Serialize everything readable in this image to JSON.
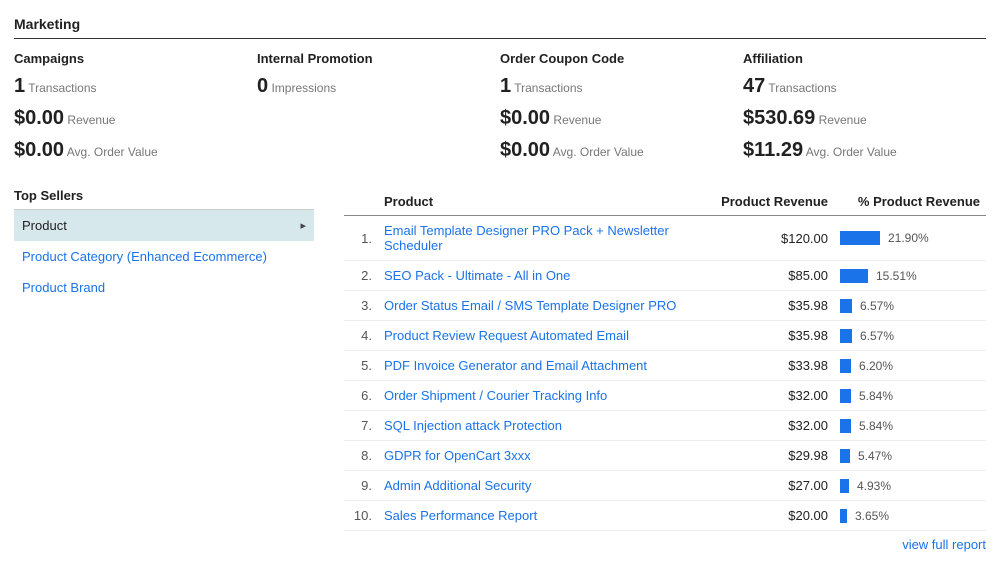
{
  "section_title": "Marketing",
  "accent": "#1a73e8",
  "metrics": [
    {
      "title": "Campaigns",
      "lines": [
        {
          "big": "1",
          "label": "Transactions"
        },
        {
          "big": "$0.00",
          "label": "Revenue"
        },
        {
          "big": "$0.00",
          "label": "Avg. Order Value"
        }
      ]
    },
    {
      "title": "Internal Promotion",
      "lines": [
        {
          "big": "0",
          "label": "Impressions"
        }
      ]
    },
    {
      "title": "Order Coupon Code",
      "lines": [
        {
          "big": "1",
          "label": "Transactions"
        },
        {
          "big": "$0.00",
          "label": "Revenue"
        },
        {
          "big": "$0.00",
          "label": "Avg. Order Value"
        }
      ]
    },
    {
      "title": "Affiliation",
      "lines": [
        {
          "big": "47",
          "label": "Transactions"
        },
        {
          "big": "$530.69",
          "label": "Revenue"
        },
        {
          "big": "$11.29",
          "label": "Avg. Order Value"
        }
      ]
    }
  ],
  "top_sellers": {
    "title": "Top Sellers",
    "items": [
      {
        "label": "Product",
        "active": true
      },
      {
        "label": "Product Category (Enhanced Ecommerce)",
        "active": false
      },
      {
        "label": "Product Brand",
        "active": false
      }
    ]
  },
  "table": {
    "columns": {
      "product": "Product",
      "revenue": "Product Revenue",
      "pct": "% Product Revenue"
    },
    "rows": [
      {
        "idx": "1.",
        "name": "Email Template Designer PRO Pack + Newsletter Scheduler",
        "revenue": "$120.00",
        "pct": "21.90%",
        "pct_val": 21.9
      },
      {
        "idx": "2.",
        "name": "SEO Pack - Ultimate - All in One",
        "revenue": "$85.00",
        "pct": "15.51%",
        "pct_val": 15.51
      },
      {
        "idx": "3.",
        "name": "Order Status Email / SMS Template Designer PRO",
        "revenue": "$35.98",
        "pct": "6.57%",
        "pct_val": 6.57
      },
      {
        "idx": "4.",
        "name": "Product Review Request Automated Email",
        "revenue": "$35.98",
        "pct": "6.57%",
        "pct_val": 6.57
      },
      {
        "idx": "5.",
        "name": "PDF Invoice Generator and Email Attachment",
        "revenue": "$33.98",
        "pct": "6.20%",
        "pct_val": 6.2
      },
      {
        "idx": "6.",
        "name": "Order Shipment / Courier Tracking Info",
        "revenue": "$32.00",
        "pct": "5.84%",
        "pct_val": 5.84
      },
      {
        "idx": "7.",
        "name": "SQL Injection attack Protection",
        "revenue": "$32.00",
        "pct": "5.84%",
        "pct_val": 5.84
      },
      {
        "idx": "8.",
        "name": "GDPR for OpenCart 3xxx",
        "revenue": "$29.98",
        "pct": "5.47%",
        "pct_val": 5.47
      },
      {
        "idx": "9.",
        "name": "Admin Additional Security",
        "revenue": "$27.00",
        "pct": "4.93%",
        "pct_val": 4.93
      },
      {
        "idx": "10.",
        "name": "Sales Performance Report",
        "revenue": "$20.00",
        "pct": "3.65%",
        "pct_val": 3.65
      }
    ]
  },
  "view_full_report": "view full report"
}
